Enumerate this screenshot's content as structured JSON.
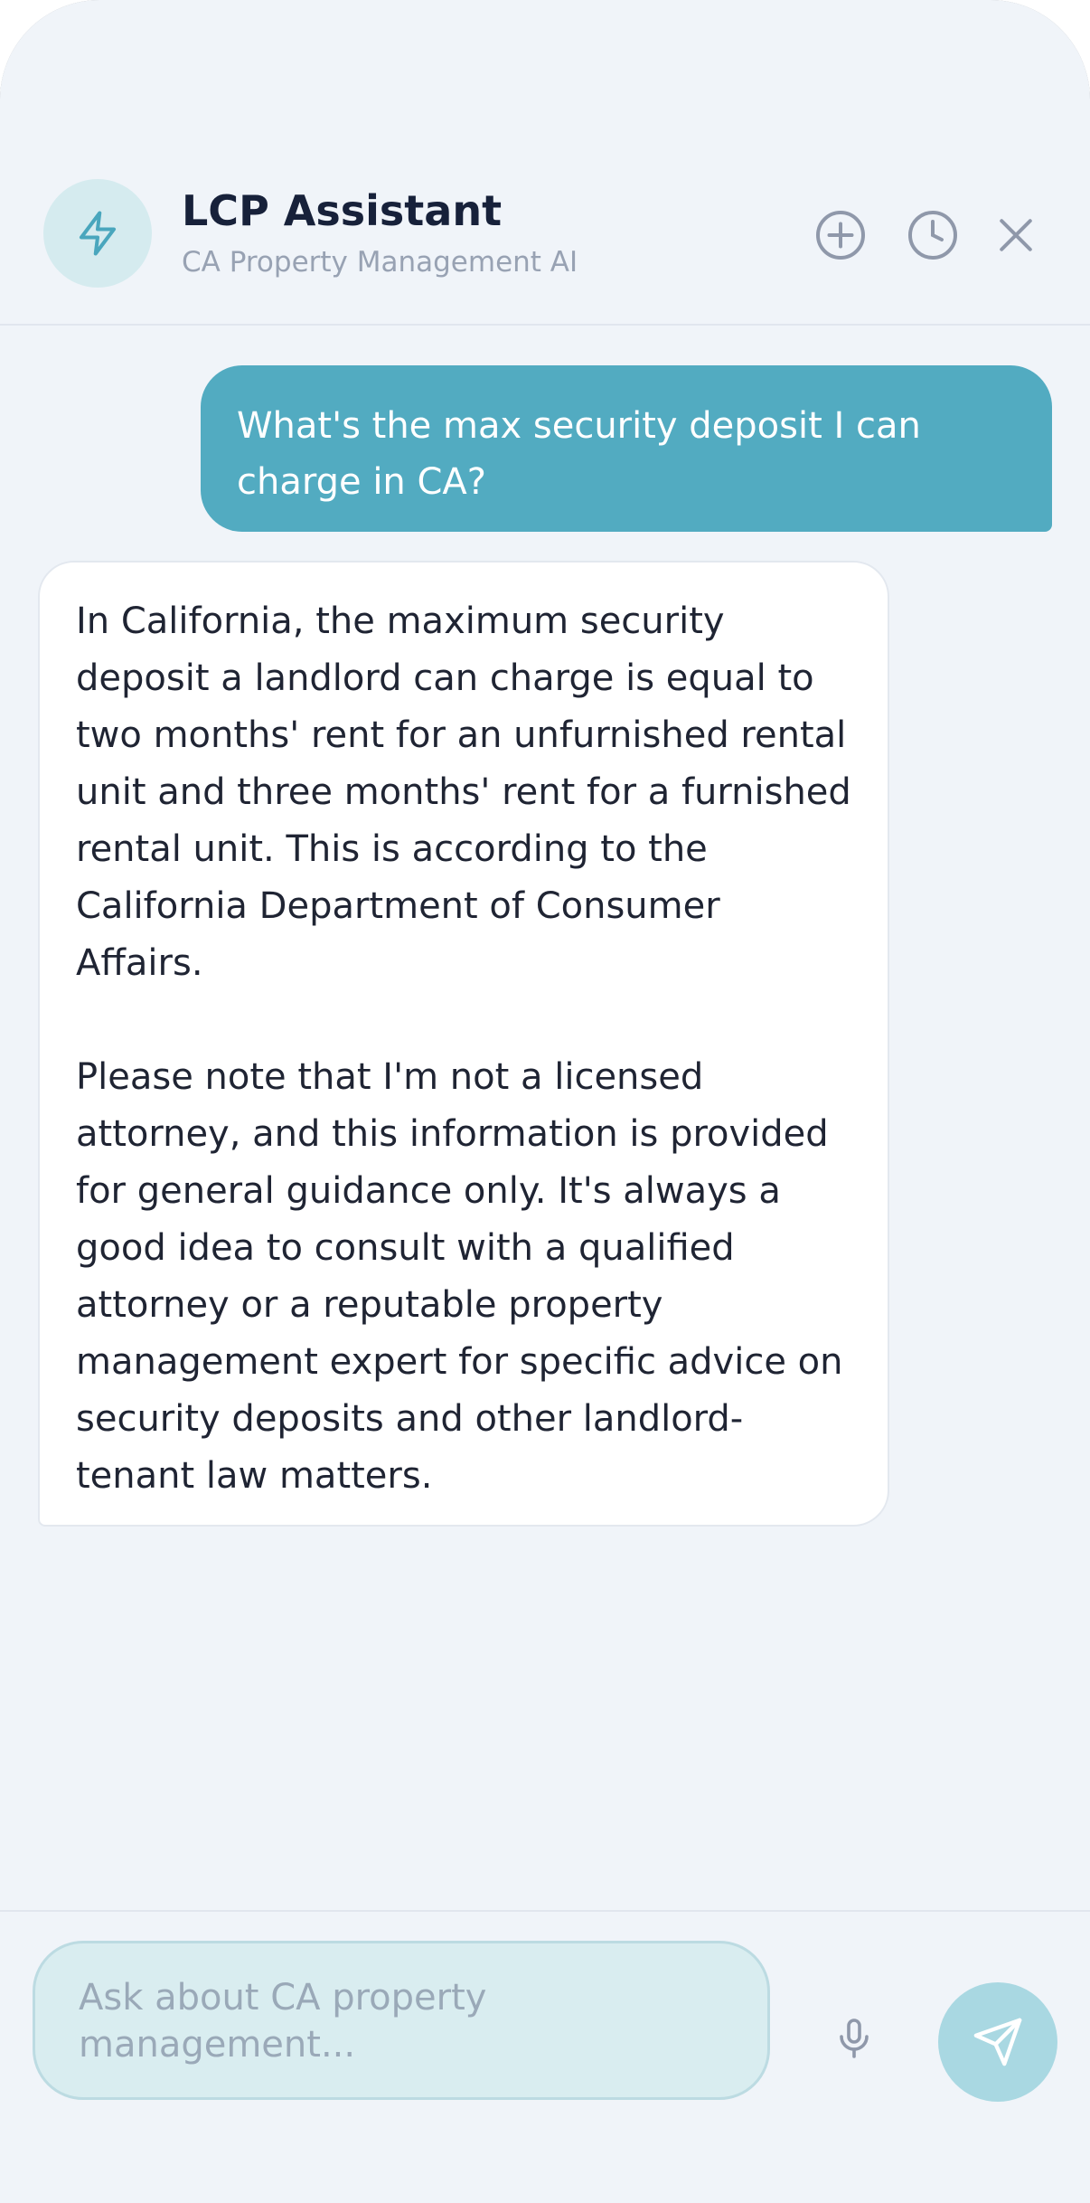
{
  "header": {
    "title": "LCP Assistant",
    "subtitle": "CA Property Management AI",
    "avatar_icon": "lightning-bolt-icon",
    "actions": [
      {
        "name": "new-chat",
        "icon": "plus-circle-icon"
      },
      {
        "name": "history",
        "icon": "clock-icon"
      },
      {
        "name": "close",
        "icon": "close-icon"
      }
    ]
  },
  "messages": [
    {
      "role": "user",
      "text": "What's the max security deposit I can charge in CA?"
    },
    {
      "role": "assistant",
      "paragraphs": [
        "In California, the maximum security deposit a landlord can charge is equal to two months' rent for an unfurnished rental unit and three months' rent for a furnished rental unit. This is according to the California Department of Consumer Affairs.",
        "Please note that I'm not a licensed attorney, and this information is provided for general guidance only. It's always a good idea to consult with a qualified attorney or a reputable property management expert for specific advice on security deposits and other landlord-tenant law matters."
      ]
    }
  ],
  "composer": {
    "placeholder": "Ask about CA property management...",
    "value": "",
    "mic_icon": "microphone-icon",
    "send_icon": "send-icon"
  },
  "colors": {
    "accent": "#52abc1",
    "background": "#f0f4f9",
    "title_text": "#17213a",
    "muted_text": "#98a2b3"
  }
}
